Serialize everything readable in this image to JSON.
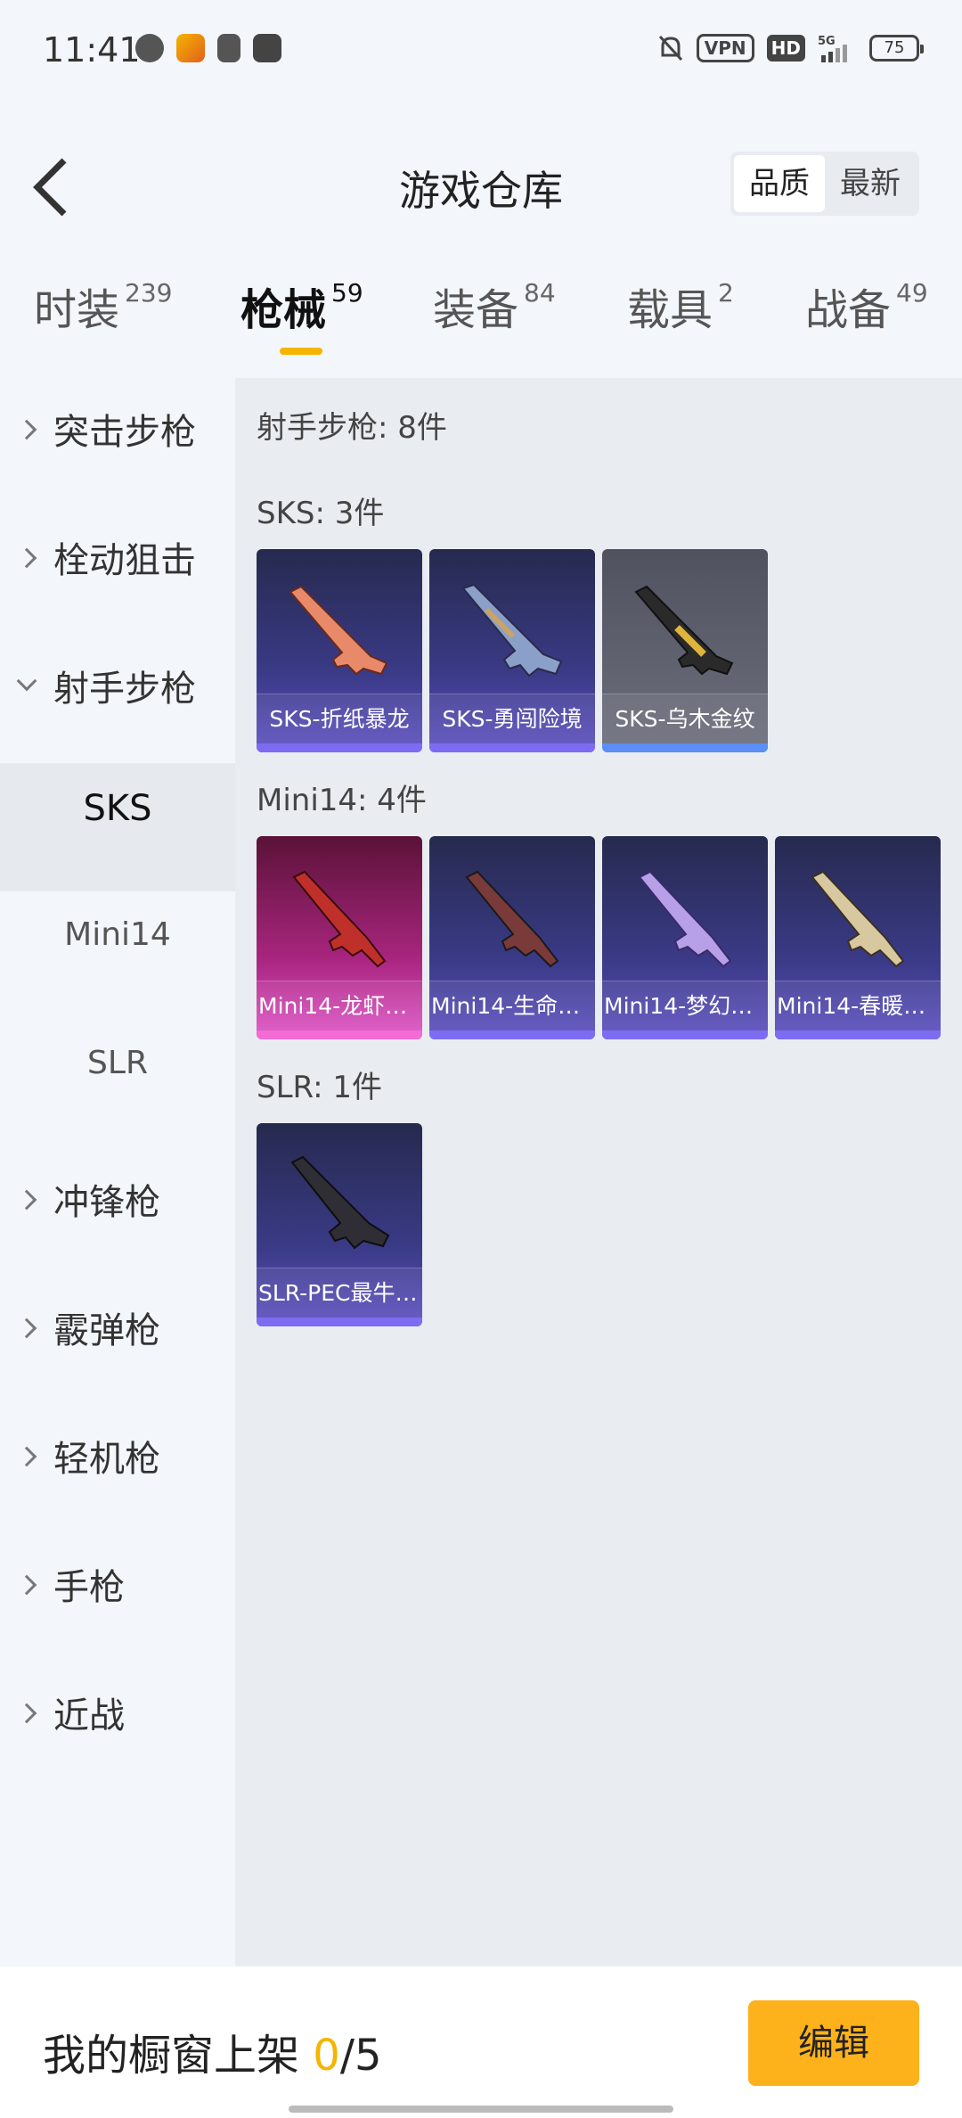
{
  "status_bar": {
    "time": "11:41",
    "vpn": "VPN",
    "hd": "HD",
    "network": "5G",
    "battery": "75"
  },
  "header": {
    "title": "游戏仓库",
    "sort_options": [
      "品质",
      "最新"
    ],
    "sort_selected": "品质"
  },
  "tabs": [
    {
      "label": "时装",
      "count": "239"
    },
    {
      "label": "枪械",
      "count": "59"
    },
    {
      "label": "装备",
      "count": "84"
    },
    {
      "label": "载具",
      "count": "2"
    },
    {
      "label": "战备",
      "count": "49"
    }
  ],
  "sidebar": {
    "items": [
      {
        "label": "突击步枪"
      },
      {
        "label": "栓动狙击"
      },
      {
        "label": "射手步枪"
      },
      {
        "label": "SKS"
      },
      {
        "label": "Mini14"
      },
      {
        "label": "SLR"
      },
      {
        "label": "冲锋枪"
      },
      {
        "label": "霰弹枪"
      },
      {
        "label": "轻机枪"
      },
      {
        "label": "手枪"
      },
      {
        "label": "近战"
      }
    ]
  },
  "content": {
    "section_title": "射手步枪: 8件",
    "groups": [
      {
        "title": "SKS: 3件",
        "items": [
          {
            "name": "SKS-折纸暴龙",
            "color": "#7d6cf2"
          },
          {
            "name": "SKS-勇闯险境",
            "color": "#7d6cf2"
          },
          {
            "name": "SKS-乌木金纹",
            "color": "#5b8ef7"
          }
        ]
      },
      {
        "title": "Mini14: 4件",
        "items": [
          {
            "name": "Mini14-龙虾…",
            "color": "#f36bd3"
          },
          {
            "name": "Mini14-生命…",
            "color": "#7d6cf2"
          },
          {
            "name": "Mini14-梦幻…",
            "color": "#7d6cf2"
          },
          {
            "name": "Mini14-春暖…",
            "color": "#7d6cf2"
          }
        ]
      },
      {
        "title": "SLR: 1件",
        "items": [
          {
            "name": "SLR-PEC最牛…",
            "color": "#7d6cf2"
          }
        ]
      }
    ]
  },
  "footer": {
    "label": "我的橱窗上架",
    "current": "0",
    "separator_total": "/5",
    "edit_label": "编辑"
  },
  "colors": {
    "accent": "#fdb21b",
    "background": "#f3f6fa"
  }
}
